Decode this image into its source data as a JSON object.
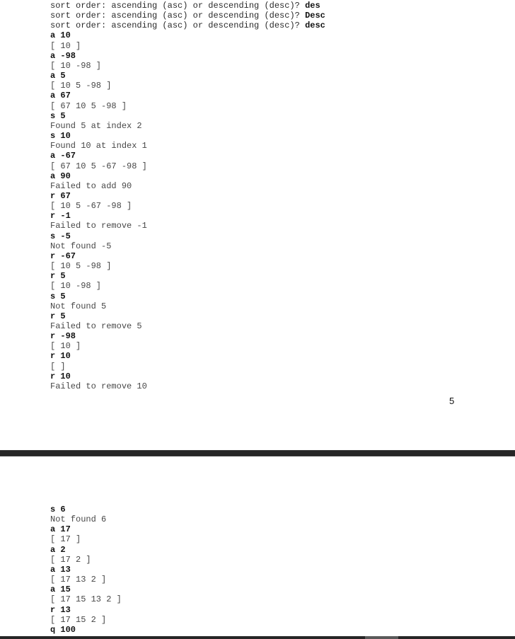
{
  "page_top": {
    "lines": [
      {
        "kind": "prompt",
        "text": "sort order: ascending (asc) or descending (desc)? ",
        "answer": "des"
      },
      {
        "kind": "prompt",
        "text": "sort order: ascending (asc) or descending (desc)? ",
        "answer": "Desc"
      },
      {
        "kind": "prompt",
        "text": "sort order: ascending (asc) or descending (desc)? ",
        "answer": "desc"
      },
      {
        "kind": "input",
        "text": "a 10"
      },
      {
        "kind": "output",
        "text": "[ 10 ]"
      },
      {
        "kind": "input",
        "text": "a -98"
      },
      {
        "kind": "output",
        "text": "[ 10 -98 ]"
      },
      {
        "kind": "input",
        "text": "a 5"
      },
      {
        "kind": "output",
        "text": "[ 10 5 -98 ]"
      },
      {
        "kind": "input",
        "text": "a 67"
      },
      {
        "kind": "output",
        "text": "[ 67 10 5 -98 ]"
      },
      {
        "kind": "input",
        "text": "s 5"
      },
      {
        "kind": "output",
        "text": "Found 5 at index 2"
      },
      {
        "kind": "input",
        "text": "s 10"
      },
      {
        "kind": "output",
        "text": "Found 10 at index 1"
      },
      {
        "kind": "input",
        "text": "a -67"
      },
      {
        "kind": "output",
        "text": "[ 67 10 5 -67 -98 ]"
      },
      {
        "kind": "input",
        "text": "a 90"
      },
      {
        "kind": "output",
        "text": "Failed to add 90"
      },
      {
        "kind": "input",
        "text": "r 67"
      },
      {
        "kind": "output",
        "text": "[ 10 5 -67 -98 ]"
      },
      {
        "kind": "input",
        "text": "r -1"
      },
      {
        "kind": "output",
        "text": "Failed to remove -1"
      },
      {
        "kind": "input",
        "text": "s -5"
      },
      {
        "kind": "output",
        "text": "Not found -5"
      },
      {
        "kind": "input",
        "text": "r -67"
      },
      {
        "kind": "output",
        "text": "[ 10 5 -98 ]"
      },
      {
        "kind": "input",
        "text": "r 5"
      },
      {
        "kind": "output",
        "text": "[ 10 -98 ]"
      },
      {
        "kind": "input",
        "text": "s 5"
      },
      {
        "kind": "output",
        "text": "Not found 5"
      },
      {
        "kind": "input",
        "text": "r 5"
      },
      {
        "kind": "output",
        "text": "Failed to remove 5"
      },
      {
        "kind": "input",
        "text": "r -98"
      },
      {
        "kind": "output",
        "text": "[ 10 ]"
      },
      {
        "kind": "input",
        "text": "r 10"
      },
      {
        "kind": "output",
        "text": "[ ]"
      },
      {
        "kind": "input",
        "text": "r 10"
      },
      {
        "kind": "output",
        "text": "Failed to remove 10"
      }
    ],
    "page_number": "5"
  },
  "page_bottom": {
    "lines": [
      {
        "kind": "input",
        "text": "s 6"
      },
      {
        "kind": "output",
        "text": "Not found 6"
      },
      {
        "kind": "input",
        "text": "a 17"
      },
      {
        "kind": "output",
        "text": "[ 17 ]"
      },
      {
        "kind": "input",
        "text": "a 2"
      },
      {
        "kind": "output",
        "text": "[ 17 2 ]"
      },
      {
        "kind": "input",
        "text": "a 13"
      },
      {
        "kind": "output",
        "text": "[ 17 13 2 ]"
      },
      {
        "kind": "input",
        "text": "a 15"
      },
      {
        "kind": "output",
        "text": "[ 17 15 13 2 ]"
      },
      {
        "kind": "input",
        "text": "r 13"
      },
      {
        "kind": "output",
        "text": "[ 17 15 2 ]"
      },
      {
        "kind": "input",
        "text": "q 100"
      }
    ]
  },
  "colors": {
    "page_background": "#ffffff",
    "page_separator": "#262626",
    "input_text": "#111111",
    "output_text": "#474747"
  }
}
